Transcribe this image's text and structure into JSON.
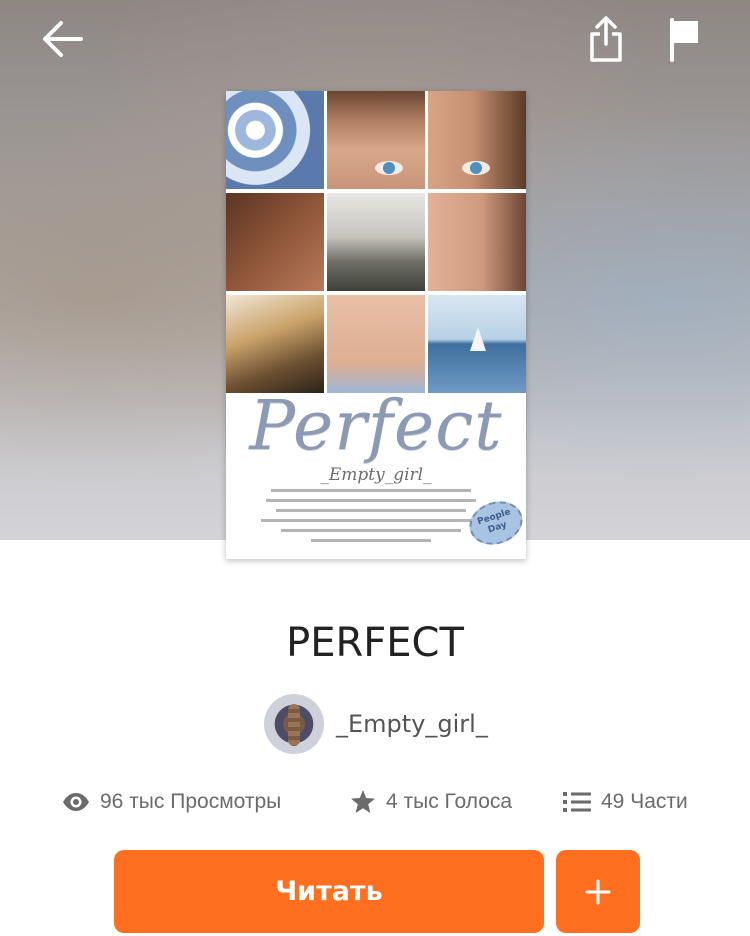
{
  "header": {
    "back_icon": "arrow-left-icon",
    "share_icon": "share-icon",
    "report_icon": "flag-icon"
  },
  "cover": {
    "title": "Perfect",
    "author": "_Empty_girl_",
    "badge": "People Day"
  },
  "story": {
    "title": "PERFECT",
    "author": "_Empty_girl_"
  },
  "stats": {
    "views": "96 тыс Просмотры",
    "votes": "4 тыс Голоса",
    "parts": "49 Части"
  },
  "actions": {
    "read_label": "Читать",
    "add_label": "+"
  },
  "colors": {
    "accent": "#ff6f1f",
    "stat_text": "#6b6b6b",
    "title_text": "#222222"
  }
}
